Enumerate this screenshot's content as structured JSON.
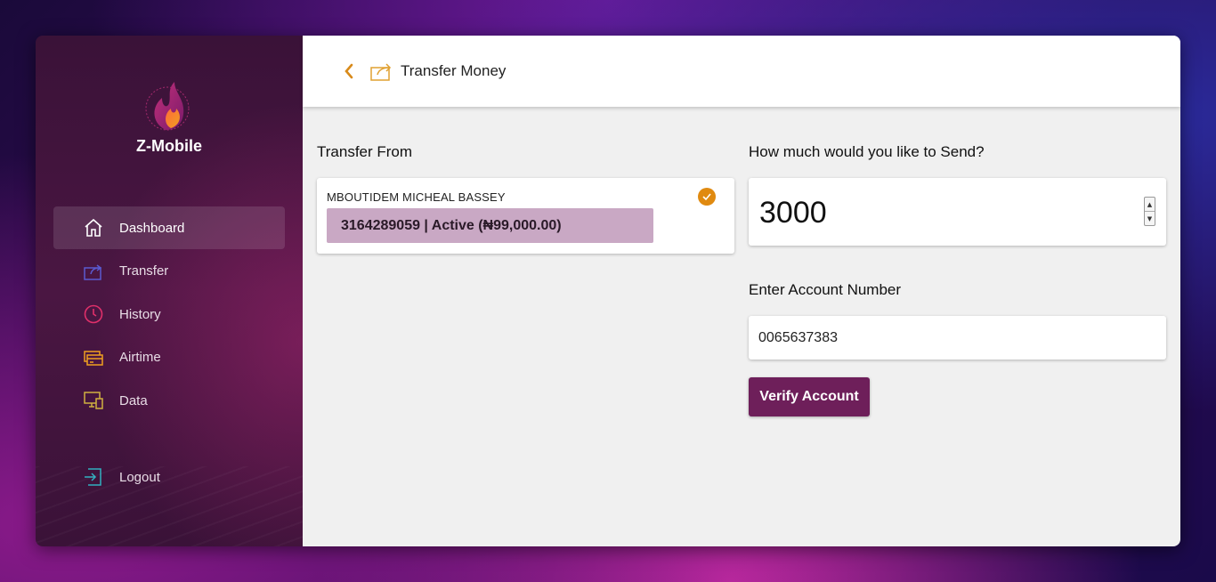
{
  "brand": {
    "name": "Z-Mobile"
  },
  "sidebar": {
    "items": [
      {
        "label": "Dashboard",
        "icon": "home-icon",
        "active": true
      },
      {
        "label": "Transfer",
        "icon": "transfer-icon"
      },
      {
        "label": "History",
        "icon": "clock-icon"
      },
      {
        "label": "Airtime",
        "icon": "cards-icon"
      },
      {
        "label": "Data",
        "icon": "devices-icon"
      }
    ],
    "logout_label": "Logout"
  },
  "header": {
    "title": "Transfer Money"
  },
  "transfer_from": {
    "label": "Transfer From",
    "account_name": "MBOUTIDEM MICHEAL BASSEY",
    "account_summary": "3164289059 | Active (₦99,000.00)"
  },
  "amount": {
    "label": "How much would you like to Send?",
    "value": "3000"
  },
  "account_number": {
    "label": "Enter Account Number",
    "value": "0065637383"
  },
  "verify_button": {
    "label": "Verify Account"
  },
  "colors": {
    "accent": "#e08a10",
    "primary_button": "#6e1f5a",
    "sidebar_bg": "#3a1238",
    "account_pill": "#c9a8c4"
  }
}
